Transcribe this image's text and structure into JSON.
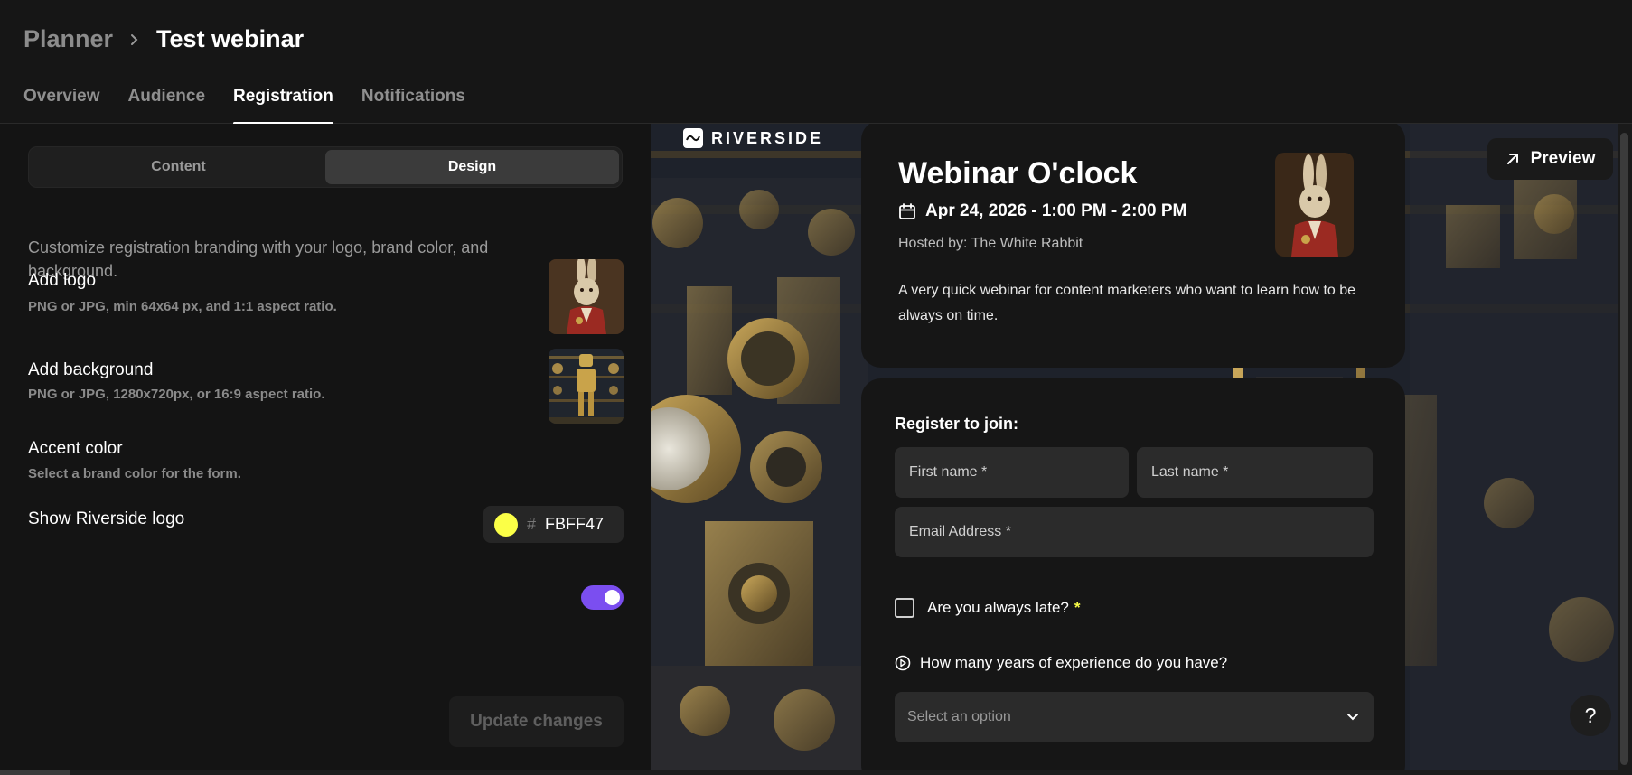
{
  "breadcrumb": {
    "parent": "Planner",
    "current": "Test webinar"
  },
  "tabs": [
    {
      "label": "Overview"
    },
    {
      "label": "Audience"
    },
    {
      "label": "Registration"
    },
    {
      "label": "Notifications"
    }
  ],
  "left": {
    "segment": {
      "content": "Content",
      "design": "Design"
    },
    "description": "Customize registration branding with your logo, brand color, and background.",
    "logo": {
      "title": "Add logo",
      "sub": "PNG or JPG, min 64x64 px, and 1:1 aspect ratio."
    },
    "background": {
      "title": "Add background",
      "sub": "PNG or JPG, 1280x720px, or 16:9 aspect ratio."
    },
    "accent": {
      "title": "Accent color",
      "sub": "Select a brand color for the form.",
      "hash": "#",
      "hex": "FBFF47",
      "color": "#fbff47"
    },
    "riverside_logo": {
      "title": "Show Riverside logo",
      "enabled": true
    },
    "update_button": "Update changes"
  },
  "preview": {
    "brand": "RIVERSIDE",
    "preview_button": "Preview",
    "webinar": {
      "title": "Webinar O'clock",
      "date": "Apr 24, 2026 - 1:00 PM - 2:00 PM",
      "host": "Hosted by: The White Rabbit",
      "description": "A very quick webinar for content marketers who want to learn how to be always on time."
    },
    "form": {
      "title": "Register to join:",
      "first_name": "First name",
      "last_name": "Last name",
      "email": "Email Address",
      "required_mark": "*",
      "checkbox_label": "Are you always late?",
      "question": "How many years of experience do you have?",
      "select_placeholder": "Select an option"
    },
    "help": "?"
  },
  "colors": {
    "accent": "#fbff47",
    "toggle": "#7b4ef0"
  }
}
